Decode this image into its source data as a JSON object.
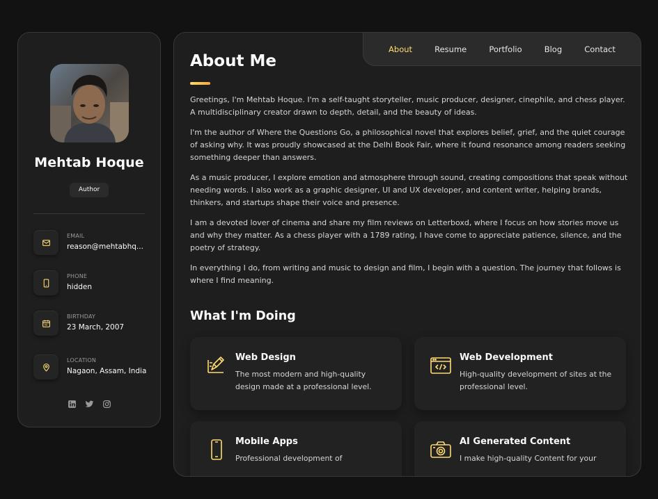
{
  "colors": {
    "accent": "#ffdb70",
    "background": "#121212",
    "card": "#1e1e1f"
  },
  "profile": {
    "name": "Mehtab Hoque",
    "title": "Author"
  },
  "contacts": [
    {
      "icon": "mail-icon",
      "label": "Email",
      "value": "reason@mehtabhq..."
    },
    {
      "icon": "phone-icon",
      "label": "Phone",
      "value": "hidden"
    },
    {
      "icon": "calendar-icon",
      "label": "Birthday",
      "value": "23 March, 2007"
    },
    {
      "icon": "location-icon",
      "label": "Location",
      "value": "Nagaon, Assam, India"
    }
  ],
  "socials": [
    "linkedin-icon",
    "twitter-icon",
    "instagram-icon"
  ],
  "nav": {
    "items": [
      {
        "label": "About",
        "active": true
      },
      {
        "label": "Resume",
        "active": false
      },
      {
        "label": "Portfolio",
        "active": false
      },
      {
        "label": "Blog",
        "active": false
      },
      {
        "label": "Contact",
        "active": false
      }
    ]
  },
  "about": {
    "title": "About Me",
    "paragraphs": [
      "Greetings, I'm Mehtab Hoque. I'm a self-taught storyteller, music producer, designer, cinephile, and chess player. A multidisciplinary creator drawn to depth, detail, and the beauty of ideas.",
      "I'm the author of Where the Questions Go, a philosophical novel that explores belief, grief, and the quiet courage of asking why. It was proudly showcased at the Delhi Book Fair, where it found resonance among readers seeking something deeper than answers.",
      "As a music producer, I explore emotion and atmosphere through sound, creating compositions that speak without needing words. I also work as a graphic designer, UI and UX developer, and content writer, helping brands, thinkers, and startups shape their voice and presence.",
      "I am a devoted lover of cinema and share my film reviews on Letterboxd, where I focus on how stories move us and why they matter. As a chess player with a 1789 rating, I have come to appreciate patience, silence, and the poetry of strategy.",
      "In everything I do, from writing and music to design and film, I begin with a question. The journey that follows is where I find meaning."
    ]
  },
  "services": {
    "title": "What I'm Doing",
    "items": [
      {
        "icon": "design-icon",
        "title": "Web Design",
        "text": "The most modern and high-quality design made at a professional level."
      },
      {
        "icon": "code-icon",
        "title": "Web Development",
        "text": "High-quality development of sites at the professional level."
      },
      {
        "icon": "mobile-icon",
        "title": "Mobile Apps",
        "text": "Professional development of"
      },
      {
        "icon": "camera-icon",
        "title": "AI Generated Content",
        "text": "I make high-quality Content for your"
      }
    ]
  }
}
